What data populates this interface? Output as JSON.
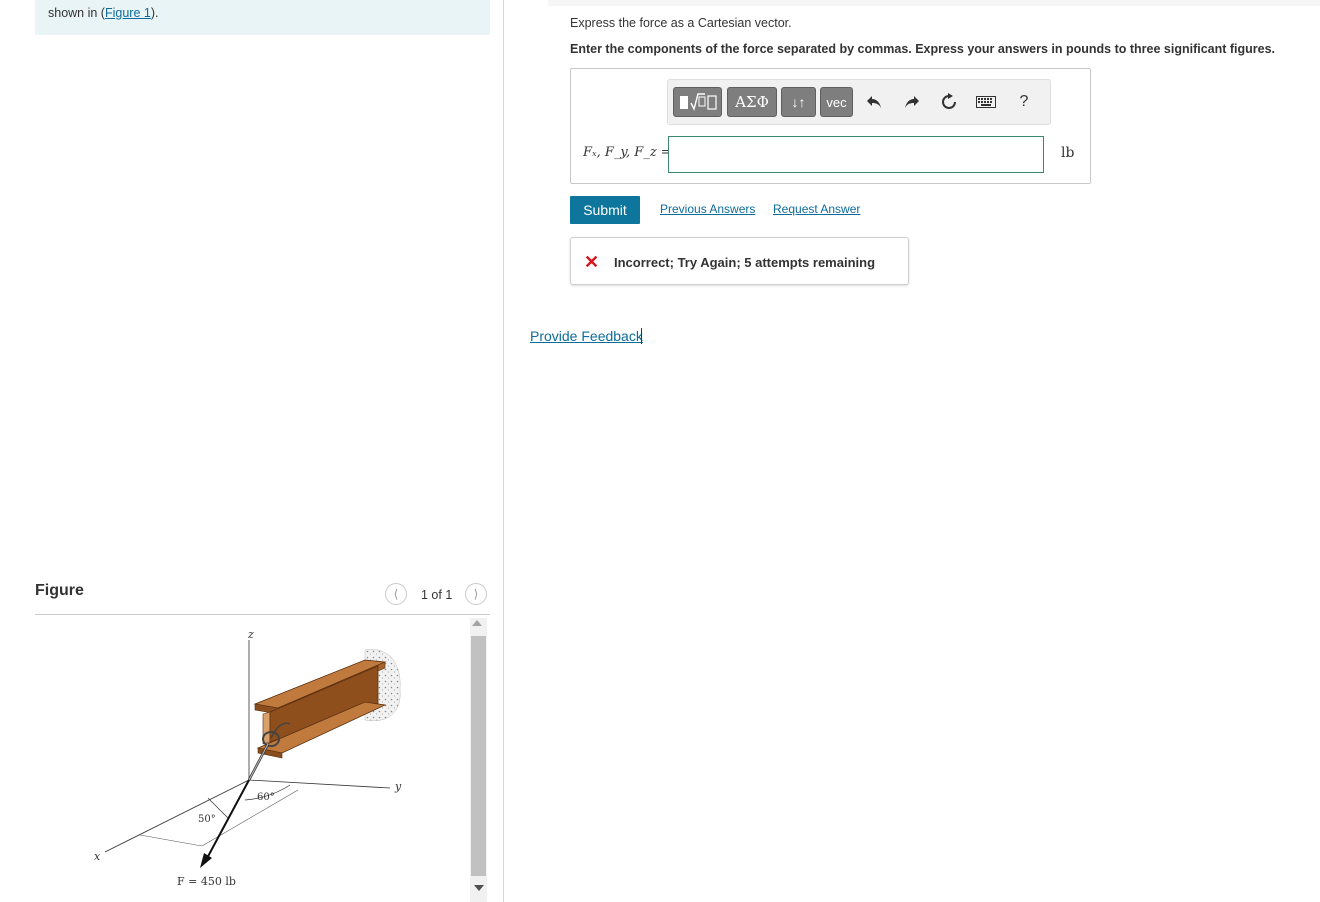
{
  "problem": {
    "text": "shown in (",
    "figure_link": "Figure 1",
    "text_end": ")."
  },
  "figure_panel": {
    "title": "Figure",
    "counter": "1 of 1",
    "prev_icon": "chevron-left-icon",
    "next_icon": "chevron-right-icon",
    "labels": {
      "z": "z",
      "y": "y",
      "x": "x",
      "angle_50": "50°",
      "angle_60": "60°",
      "force": "F = 450 lb"
    }
  },
  "question": {
    "instruction": "Express the force as a Cartesian vector.",
    "instruction_bold": "Enter the components of the force separated by commas. Express your answers in pounds to three significant figures."
  },
  "toolbar": {
    "templates_icon": "▮√▯",
    "greek": "ΑΣΦ",
    "arrows": "↓↑",
    "vec": "vec",
    "undo_icon": "undo-icon",
    "redo_icon": "redo-icon",
    "reset_icon": "reset-icon",
    "keyboard_icon": "keyboard-icon",
    "help": "?"
  },
  "answer": {
    "label": "Fₓ, F_y, F_z =",
    "value": "",
    "unit": "lb"
  },
  "actions": {
    "submit": "Submit",
    "previous_answers": "Previous Answers",
    "request_answer": "Request Answer"
  },
  "feedback": {
    "message": "Incorrect; Try Again; 5 attempts remaining"
  },
  "provide_feedback": "Provide Feedback",
  "colors": {
    "accent": "#0e769d",
    "error": "#d9141b",
    "input_border": "#3c8a6b"
  }
}
